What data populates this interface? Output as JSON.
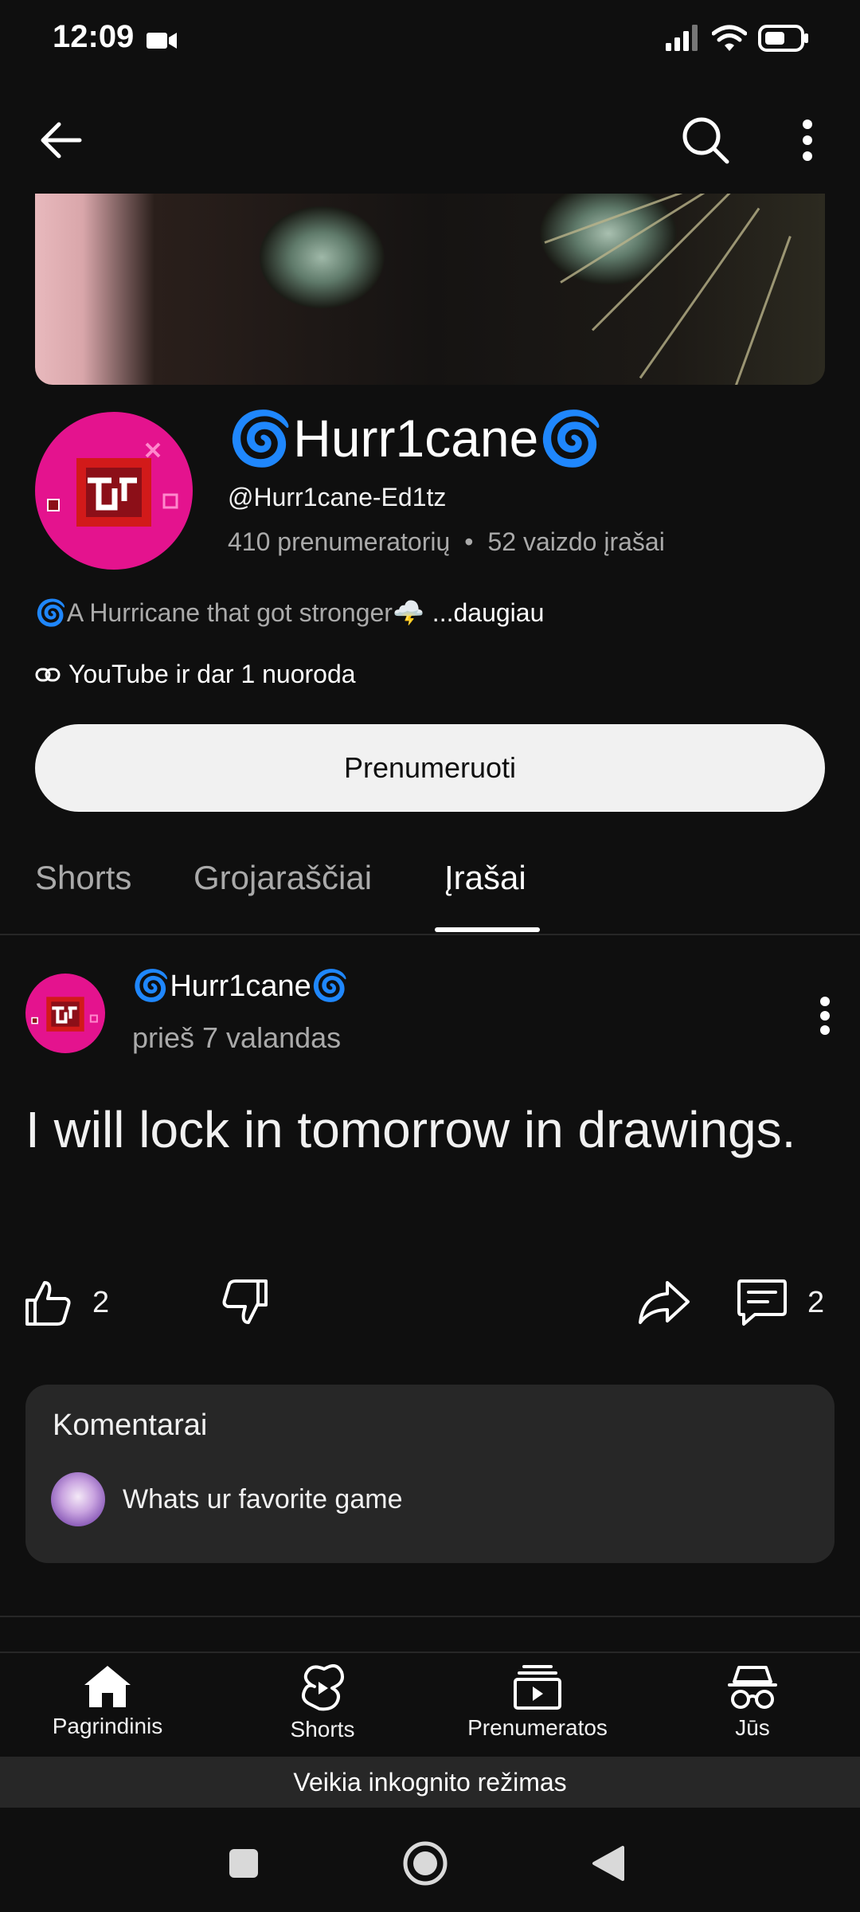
{
  "status_bar": {
    "time": "12:09"
  },
  "channel": {
    "name": "🌀Hurr1cane🌀",
    "handle": "@Hurr1cane-Ed1tz",
    "subscribers": "410 prenumeratorių",
    "separator": "•",
    "videos": "52 vaizdo įrašai",
    "description": "🌀A Hurricane that got stronger🌩️",
    "description_more": "...daugiau",
    "links": "YouTube ir dar 1 nuoroda",
    "subscribe_label": "Prenumeruoti"
  },
  "tabs": [
    {
      "label": "Shorts",
      "active": false
    },
    {
      "label": "Grojaraščiai",
      "active": false
    },
    {
      "label": "Įrašai",
      "active": true
    }
  ],
  "post": {
    "author": "🌀Hurr1cane🌀",
    "time": "prieš 7 valandas",
    "text": "I will lock in tomorrow in drawings.",
    "likes": "2",
    "comments": "2"
  },
  "comments_card": {
    "title": "Komentarai",
    "preview": "Whats ur favorite game"
  },
  "bottom_nav": [
    {
      "label": "Pagrindinis",
      "icon": "home-icon"
    },
    {
      "label": "Shorts",
      "icon": "shorts-icon"
    },
    {
      "label": "Prenumeratos",
      "icon": "subscriptions-icon"
    },
    {
      "label": "Jūs",
      "icon": "incognito-icon"
    }
  ],
  "incognito_banner": "Veikia inkognito režimas",
  "colors": {
    "background": "#0f0f0f",
    "avatar_pink": "#e4138e",
    "subscribe_bg": "#f1f1f1",
    "card_bg": "#272727",
    "secondary_text": "#aaaaaa"
  }
}
